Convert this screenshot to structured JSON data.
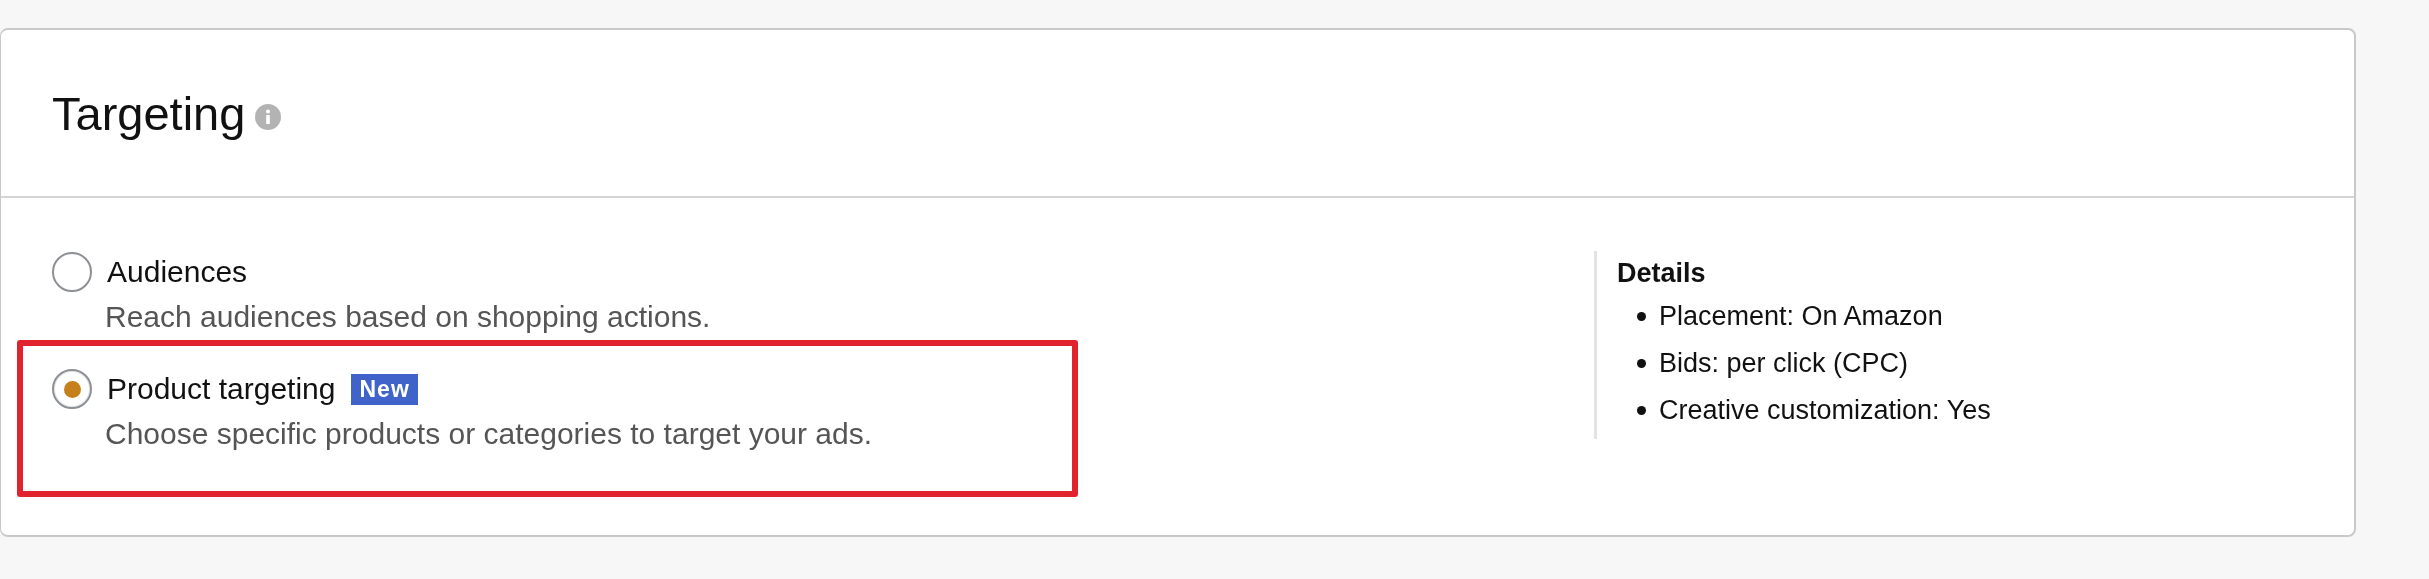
{
  "panel": {
    "title": "Targeting"
  },
  "options": [
    {
      "label": "Audiences",
      "description": "Reach audiences based on shopping actions.",
      "selected": false,
      "highlighted": false
    },
    {
      "label": "Product targeting",
      "badge": "New",
      "description": "Choose specific products or categories to target your ads.",
      "selected": true,
      "highlighted": true
    }
  ],
  "details": {
    "title": "Details",
    "items": [
      "Placement: On Amazon",
      "Bids: per click (CPC)",
      "Creative customization: Yes"
    ]
  }
}
